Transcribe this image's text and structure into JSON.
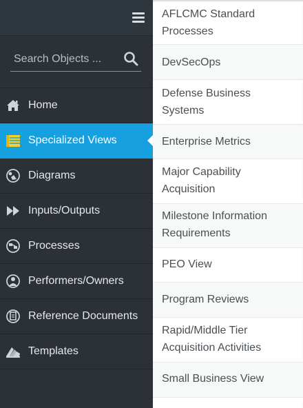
{
  "search": {
    "placeholder": "Search Objects ..."
  },
  "nav": {
    "items": [
      {
        "label": "Home",
        "icon": "home-icon"
      },
      {
        "label": "Specialized Views",
        "icon": "list-icon",
        "active": true
      },
      {
        "label": "Diagrams",
        "icon": "diagram-icon"
      },
      {
        "label": "Inputs/Outputs",
        "icon": "fast-forward-icon"
      },
      {
        "label": "Processes",
        "icon": "processes-icon"
      },
      {
        "label": "Performers/Owners",
        "icon": "person-icon"
      },
      {
        "label": "Reference Documents",
        "icon": "document-icon"
      },
      {
        "label": "Templates",
        "icon": "templates-icon"
      }
    ]
  },
  "submenu": {
    "items": [
      {
        "label": "AFLCMC Standard\nProcesses"
      },
      {
        "label": "DevSecOps"
      },
      {
        "label": "Defense Business\nSystems"
      },
      {
        "label": "Enterprise Metrics"
      },
      {
        "label": "Major Capability\nAcquisition"
      },
      {
        "label": "Milestone Information\nRequirements"
      },
      {
        "label": "PEO View"
      },
      {
        "label": "Program Reviews"
      },
      {
        "label": "Rapid/Middle Tier\nAcquisition Activities"
      },
      {
        "label": "Small Business View"
      }
    ]
  },
  "colors": {
    "sidebar": "#2b3136",
    "active": "#16a0df",
    "submenu_text": "#4a4f54"
  }
}
